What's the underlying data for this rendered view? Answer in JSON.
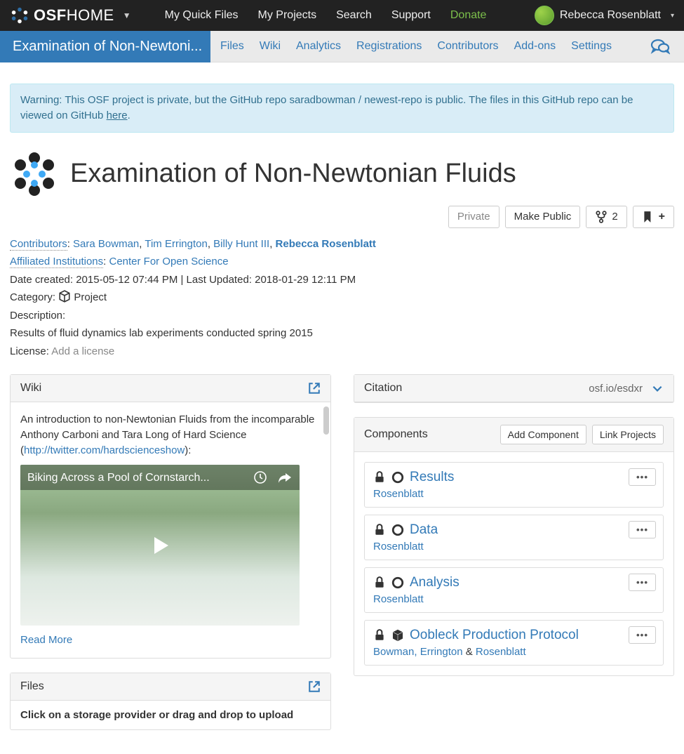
{
  "nav": {
    "brand_bold": "OSF",
    "brand_light": "HOME",
    "links": [
      "My Quick Files",
      "My Projects",
      "Search",
      "Support",
      "Donate"
    ],
    "user": "Rebecca Rosenblatt"
  },
  "subnav": {
    "project_tab": "Examination of Non-Newtoni...",
    "links": [
      "Files",
      "Wiki",
      "Analytics",
      "Registrations",
      "Contributors",
      "Add-ons",
      "Settings"
    ]
  },
  "alert": {
    "prefix": "Warning: This OSF project is private, but the GitHub repo saradbowman / newest-repo is public. The files in this GitHub repo can be viewed on GitHub ",
    "link": "here",
    "suffix": "."
  },
  "project": {
    "title": "Examination of Non-Newtonian Fluids",
    "privacy_label": "Private",
    "make_public": "Make Public",
    "fork_count": "2"
  },
  "meta": {
    "contributors_label": "Contributors",
    "contributors": [
      "Sara Bowman",
      "Tim Errington",
      "Billy Hunt III",
      "Rebecca Rosenblatt"
    ],
    "aff_label": "Affiliated Institutions",
    "aff_value": "Center For Open Science",
    "dates": "Date created: 2015-05-12 07:44 PM | Last Updated: 2018-01-29 12:11 PM",
    "category_label": "Category:",
    "category_value": "Project",
    "description_label": "Description:",
    "description_value": "Results of fluid dynamics lab experiments conducted spring 2015",
    "license_label": "License:",
    "license_link": "Add a license"
  },
  "wiki": {
    "heading": "Wiki",
    "intro_pre": "An introduction to non-Newtonian Fluids from the incomparable Anthony Carboni and Tara Long of Hard Science (",
    "intro_link": "http://twitter.com/hardscienceshow",
    "intro_post": "):",
    "video_title": "Biking Across a Pool of Cornstarch...",
    "read_more": "Read More"
  },
  "files": {
    "heading": "Files",
    "body": "Click on a storage provider or drag and drop to upload"
  },
  "citation": {
    "heading": "Citation",
    "url": "osf.io/esdxr"
  },
  "components": {
    "heading": "Components",
    "add_btn": "Add Component",
    "link_btn": "Link Projects",
    "items": [
      {
        "title": "Results",
        "contrib_html": "Rosenblatt",
        "icon": "circle"
      },
      {
        "title": "Data",
        "contrib_html": "Rosenblatt",
        "icon": "circle"
      },
      {
        "title": "Analysis",
        "contrib_html": "Rosenblatt",
        "icon": "circle"
      },
      {
        "title": "Oobleck Production Protocol",
        "contrib_html": "Bowman, Errington & Rosenblatt",
        "icon": "cube"
      }
    ]
  }
}
